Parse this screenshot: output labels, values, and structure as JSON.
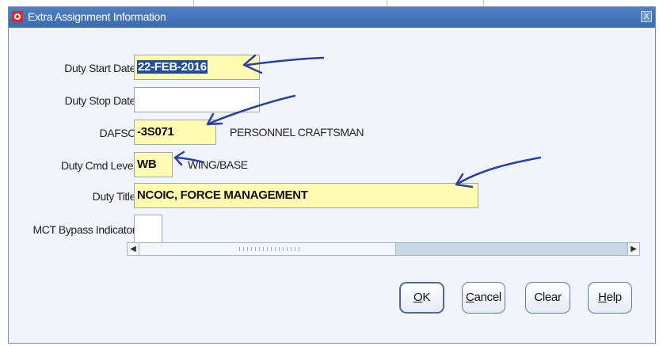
{
  "window": {
    "title": "Extra Assignment Information",
    "close_symbol": "X",
    "icon": "oracle-app-icon"
  },
  "form": {
    "duty_start_date": {
      "label": "Duty Start Date",
      "value": "22-FEB-2016"
    },
    "duty_stop_date": {
      "label": "Duty Stop Date",
      "value": ""
    },
    "dafsc": {
      "label": "DAFSC",
      "value": "-3S071",
      "description": "PERSONNEL CRAFTSMAN"
    },
    "duty_cmd_level": {
      "label": "Duty Cmd Level",
      "value": "WB",
      "description": "WING/BASE"
    },
    "duty_title": {
      "label": "Duty Title",
      "value": "NCOIC, FORCE MANAGEMENT"
    },
    "mct_bypass": {
      "label": "MCT Bypass Indicator",
      "value": ""
    }
  },
  "scrollbar": {
    "left_arrow": "◀",
    "right_arrow": "▶"
  },
  "buttons": {
    "ok": {
      "mnemonic": "O",
      "rest": "K"
    },
    "cancel": {
      "mnemonic": "C",
      "rest": "ancel"
    },
    "clear": {
      "mnemonic": "",
      "rest": "Clear"
    },
    "help": {
      "mnemonic": "H",
      "rest": "elp"
    }
  },
  "colors": {
    "required_field": "#fffbb0",
    "title_bar": "#3a6cb3",
    "annotation_ink": "#2a3fa8"
  }
}
